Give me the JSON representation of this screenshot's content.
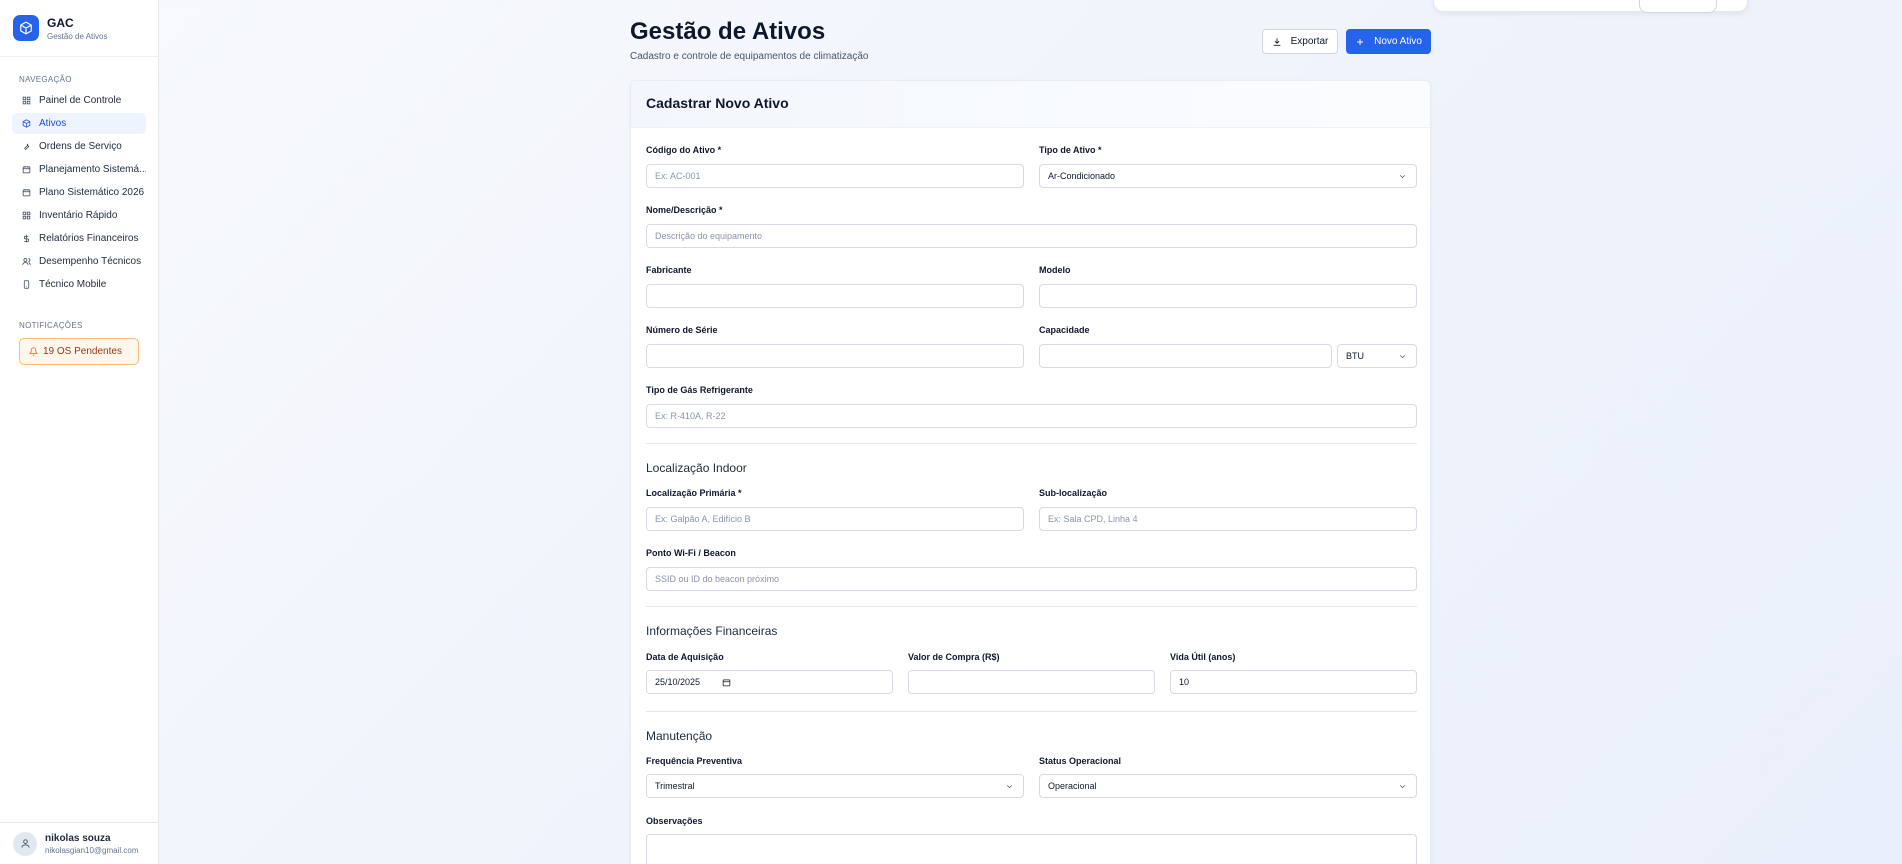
{
  "brand": {
    "title": "GAC",
    "subtitle": "Gestão de Ativos"
  },
  "nav": {
    "section_title": "NAVEGAÇÃO",
    "items": [
      {
        "label": "Painel de Controle",
        "icon": "dashboard-icon"
      },
      {
        "label": "Ativos",
        "icon": "box-icon",
        "active": true
      },
      {
        "label": "Ordens de Serviço",
        "icon": "wrench-icon"
      },
      {
        "label": "Planejamento Sistemá...",
        "icon": "calendar-icon"
      },
      {
        "label": "Plano Sistemático 2026",
        "icon": "calendar-icon"
      },
      {
        "label": "Inventário Rápido",
        "icon": "grid-icon"
      },
      {
        "label": "Relatórios Financeiros",
        "icon": "dollar-icon"
      },
      {
        "label": "Desempenho Técnicos",
        "icon": "users-icon"
      },
      {
        "label": "Técnico Mobile",
        "icon": "phone-icon"
      }
    ]
  },
  "notifications": {
    "section_title": "NOTIFICAÇÕES",
    "badge": "19 OS Pendentes"
  },
  "user": {
    "name": "nikolas souza",
    "email": "nikolasgian10@gmail.com"
  },
  "header": {
    "title": "Gestão de Ativos",
    "subtitle": "Cadastro e controle de equipamentos de climatização",
    "export_label": "Exportar",
    "new_label": "Novo Ativo"
  },
  "form": {
    "title": "Cadastrar Novo Ativo",
    "codigo": {
      "label": "Código do Ativo *",
      "placeholder": "Ex: AC-001"
    },
    "tipo": {
      "label": "Tipo de Ativo *",
      "value": "Ar-Condicionado"
    },
    "nome": {
      "label": "Nome/Descrição *",
      "placeholder": "Descrição do equipamento"
    },
    "fabricante": {
      "label": "Fabricante",
      "value": ""
    },
    "modelo": {
      "label": "Modelo",
      "value": ""
    },
    "serie": {
      "label": "Número de Série",
      "value": ""
    },
    "capacidade": {
      "label": "Capacidade",
      "value": "",
      "unit": "BTU"
    },
    "gas": {
      "label": "Tipo de Gás Refrigerante",
      "placeholder": "Ex: R-410A, R-22"
    },
    "indoor": {
      "section": "Localização Indoor",
      "primaria": {
        "label": "Localização Primária *",
        "placeholder": "Ex: Galpão A, Edifício B"
      },
      "sub": {
        "label": "Sub-localização",
        "placeholder": "Ex: Sala CPD, Linha 4"
      },
      "wifi": {
        "label": "Ponto Wi-Fi / Beacon",
        "placeholder": "SSID ou ID do beacon próximo"
      }
    },
    "financeiro": {
      "section": "Informações Financeiras",
      "data": {
        "label": "Data de Aquisição",
        "value": "25/10/2025"
      },
      "valor": {
        "label": "Valor de Compra (R$)",
        "value": ""
      },
      "vida": {
        "label": "Vida Útil (anos)",
        "value": "10"
      }
    },
    "manutencao": {
      "section": "Manutenção",
      "frequencia": {
        "label": "Frequência Preventiva",
        "value": "Trimestral"
      },
      "status": {
        "label": "Status Operacional",
        "value": "Operacional"
      },
      "obs": {
        "label": "Observações",
        "value": ""
      }
    }
  },
  "colors": {
    "primary": "#2563eb",
    "warning_bg": "#fff7ed",
    "warning_border": "#fdba74"
  }
}
